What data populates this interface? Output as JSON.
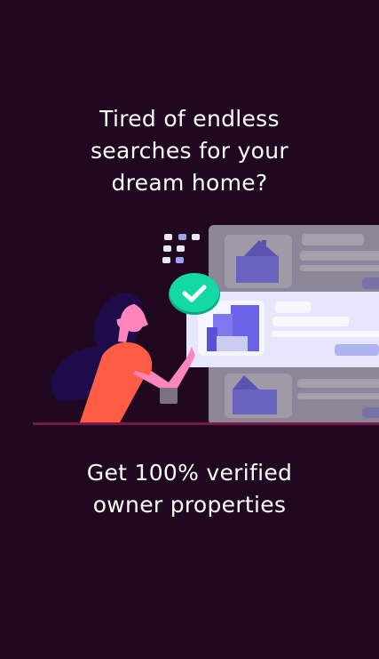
{
  "intro": {
    "headline_lines": [
      "Tired of endless",
      "searches for your",
      "dream home?"
    ],
    "tagline_lines": [
      "Get 100% verified",
      "owner properties"
    ]
  },
  "illustration": {
    "icons": [
      "woman-pointing",
      "check-icon",
      "property-listing-cards",
      "house-icon",
      "building-icon"
    ],
    "colors": {
      "background": "#200820",
      "check": "#12d9a6",
      "shirt": "#ff5c45",
      "accent": "#6b63d9"
    }
  }
}
